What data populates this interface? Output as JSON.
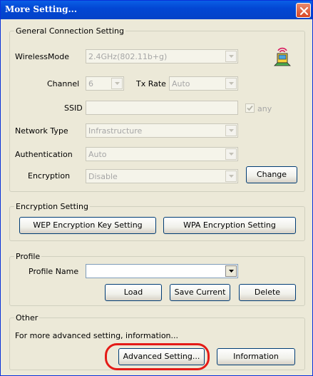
{
  "window": {
    "title": "More Setting..."
  },
  "general": {
    "legend": "General Connection Setting",
    "wireless_mode_label": "WirelessMode",
    "wireless_mode_value": "2.4GHz(802.11b+g)",
    "channel_label": "Channel",
    "channel_value": "6",
    "tx_rate_label": "Tx Rate",
    "tx_rate_value": "Auto",
    "ssid_label": "SSID",
    "ssid_value": "",
    "any_label": "any",
    "any_checked": true,
    "network_type_label": "Network Type",
    "network_type_value": "Infrastructure",
    "authentication_label": "Authentication",
    "authentication_value": "Auto",
    "encryption_label": "Encryption",
    "encryption_value": "Disable",
    "change_button": "Change"
  },
  "encryption_setting": {
    "legend": "Encryption Setting",
    "wep_button": "WEP Encryption Key Setting",
    "wpa_button": "WPA Encryption Setting"
  },
  "profile": {
    "legend": "Profile",
    "name_label": "Profile Name",
    "name_value": "",
    "load_button": "Load",
    "save_button": "Save Current",
    "delete_button": "Delete"
  },
  "other": {
    "legend": "Other",
    "description": "For more advanced setting, information...",
    "advanced_button": "Advanced Setting...",
    "information_button": "Information"
  },
  "colors": {
    "titlebar": "#0347d4",
    "highlight": "#e41b17",
    "window_bg": "#ece9d8"
  },
  "icons": [
    "wireless-adapter-icon",
    "close-icon",
    "dropdown-arrow-icon",
    "checkmark-icon"
  ]
}
